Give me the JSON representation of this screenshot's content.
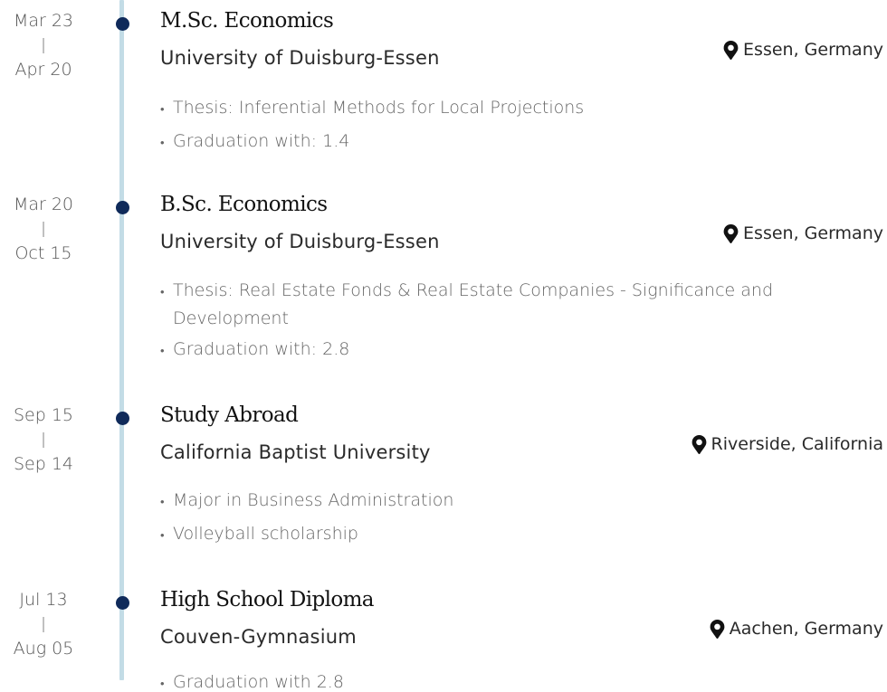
{
  "education": [
    {
      "date_start": "Mar 23",
      "date_sep": "|",
      "date_end": "Apr 20",
      "degree": "M.Sc. Economics",
      "institution": "University of Duisburg-Essen",
      "location": "Essen, Germany",
      "bullets": [
        "Thesis: Inferential Methods for Local Projections",
        "Graduation with: 1.4"
      ]
    },
    {
      "date_start": "Mar 20",
      "date_sep": "|",
      "date_end": "Oct 15",
      "degree": "B.Sc. Economics",
      "institution": "University of Duisburg-Essen",
      "location": "Essen, Germany",
      "bullets": [
        "Thesis: Real Estate Fonds & Real Estate Companies - Significance and Development",
        "Graduation with: 2.8"
      ]
    },
    {
      "date_start": "Sep 15",
      "date_sep": "|",
      "date_end": "Sep 14",
      "degree": "Study Abroad",
      "institution": "California Baptist University",
      "location": "Riverside, California",
      "bullets": [
        "Major in Business Administration",
        "Volleyball scholarship"
      ]
    },
    {
      "date_start": "Jul 13",
      "date_sep": "|",
      "date_end": "Aug 05",
      "degree": "High School Diploma",
      "institution": "Couven-Gymnasium",
      "location": "Aachen, Germany",
      "bullets": [
        "Graduation with 2.8"
      ]
    }
  ],
  "icons": {
    "location": "map-pin-icon",
    "timeline_marker": "dot"
  },
  "colors": {
    "dot": "#0f2a5a",
    "timeline": "#c3dce6",
    "muted_text": "#666666"
  }
}
